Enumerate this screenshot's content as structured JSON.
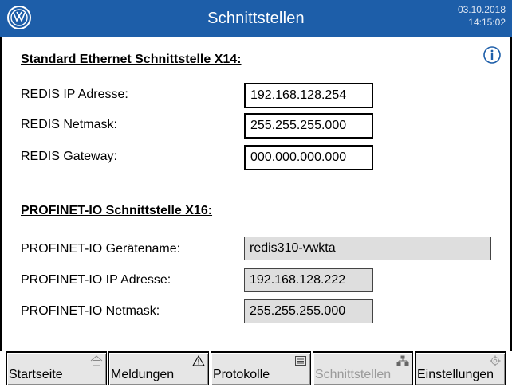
{
  "header": {
    "title": "Schnittstellen",
    "date": "03.10.2018",
    "time": "14:15:02",
    "brand_color": "#1d5ea9"
  },
  "ethernet": {
    "title": "Standard Ethernet Schnittstelle X14:",
    "ip_label": "REDIS IP Adresse:",
    "ip_value": "192.168.128.254",
    "netmask_label": "REDIS Netmask:",
    "netmask_value": "255.255.255.000",
    "gateway_label": "REDIS Gateway:",
    "gateway_value": "000.000.000.000"
  },
  "profinet": {
    "title": "PROFINET-IO Schnittstelle X16:",
    "name_label": "PROFINET-IO Gerätename:",
    "name_value": "redis310-vwkta",
    "ip_label": "PROFINET-IO IP Adresse:",
    "ip_value": "192.168.128.222",
    "netmask_label": "PROFINET-IO Netmask:",
    "netmask_value": "255.255.255.000"
  },
  "nav": {
    "startseite": "Startseite",
    "meldungen": "Meldungen",
    "protokolle": "Protokolle",
    "schnittstellen": "Schnittstellen",
    "einstellungen": "Einstellungen"
  },
  "icons": {
    "logo": "vw-logo",
    "info": "info-icon",
    "home": "home-icon",
    "warning": "warning-icon",
    "list": "list-icon",
    "network": "network-icon",
    "gear": "gear-icon"
  }
}
